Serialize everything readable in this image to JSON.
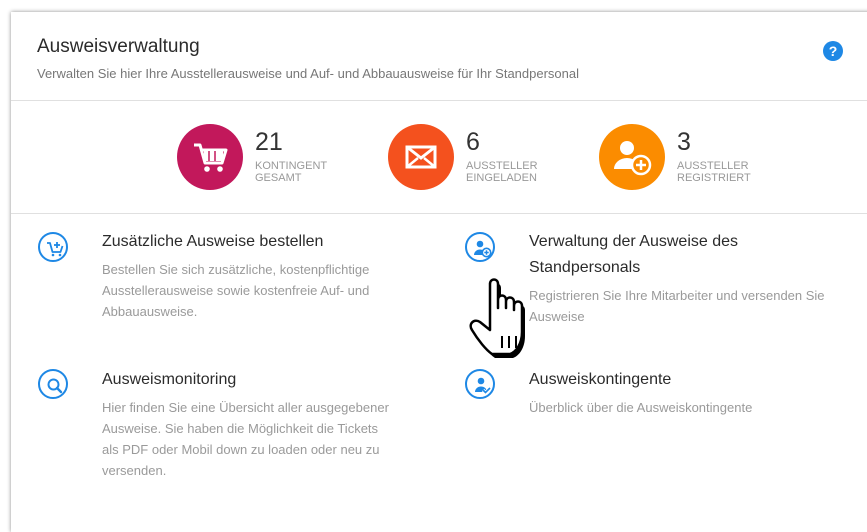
{
  "header": {
    "title": "Ausweisverwaltung",
    "subtitle": "Verwalten Sie hier Ihre Ausstellerausweise und Auf- und Abbauausweise für Ihr Standpersonal",
    "help_label": "?"
  },
  "stats": [
    {
      "value": "21",
      "label1": "KONTINGENT",
      "label2": "GESAMT",
      "color": "#c2185b",
      "icon": "cart-icon"
    },
    {
      "value": "6",
      "label1": "AUSSTELLER",
      "label2": "EINGELADEN",
      "color": "#f4511e",
      "icon": "envelope-icon"
    },
    {
      "value": "3",
      "label1": "AUSSTELLER",
      "label2": "REGISTRIERT",
      "color": "#fb8c00",
      "icon": "user-add-icon"
    }
  ],
  "items": [
    {
      "title": "Zusätzliche Ausweise bestellen",
      "lines": [
        "Bestellen Sie sich zusätzliche, kostenpflichtige",
        "Ausstellerausweise sowie kostenfreie Auf- und",
        "Abbauausweise."
      ],
      "icon": "cart-add-icon"
    },
    {
      "title_lines": [
        "Verwaltung der Ausweise des",
        "Standpersonals"
      ],
      "lines": [
        "Registrieren Sie Ihre Mitarbeiter und versenden Sie",
        "Ausweise"
      ],
      "icon": "user-add-icon"
    },
    {
      "title": "Ausweismonitoring",
      "lines": [
        "Hier finden Sie eine Übersicht aller ausgegebener",
        "Ausweise. Sie haben die Möglichkeit die Tickets",
        "als PDF oder Mobil down zu loaden oder neu zu",
        "versenden."
      ],
      "icon": "search-icon"
    },
    {
      "title": "Ausweiskontingente",
      "lines": [
        "Überblick über die Ausweiskontingente"
      ],
      "icon": "user-check-icon"
    }
  ],
  "colors": {
    "accent": "#1e88e5"
  },
  "cursor_icon": "hand-pointer-icon"
}
